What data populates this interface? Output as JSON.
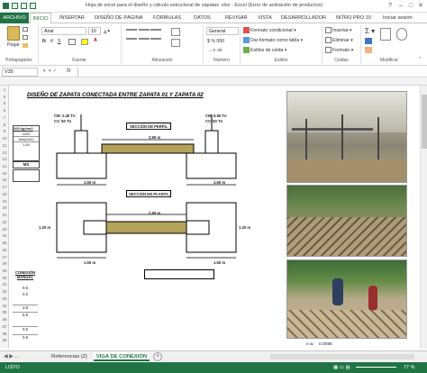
{
  "window": {
    "title": "Hoja de excel para el diseño y cálculo estructural de zapatas .xlsx - Excel (Error de activación de productos)",
    "sign_in": "Iniciar sesión"
  },
  "tabs": {
    "file": "ARCHIVO",
    "items": [
      "INICIO",
      "INSERTAR",
      "DISEÑO DE PÁGINA",
      "FÓRMULAS",
      "DATOS",
      "REVISAR",
      "VISTA",
      "DESARROLLADOR",
      "NITRO PRO 10"
    ]
  },
  "ribbon": {
    "paste": "Pegar",
    "font_name": "Arial",
    "font_size": "10",
    "number_format": "General",
    "conditional_format": "Formato condicional",
    "table_format": "Dar formato como tabla",
    "cell_styles": "Estilos de celda",
    "insert": "Insertar",
    "delete": "Eliminar",
    "format": "Formato",
    "groups": {
      "clipboard": "Portapapeles",
      "font": "Fuente",
      "alignment": "Alineación",
      "number": "Número",
      "styles": "Estilos",
      "cells": "Celdas",
      "modify": "Modificar"
    }
  },
  "formula_bar": {
    "namebox": "V35",
    "fx": "fx"
  },
  "sheet": {
    "title": "DISEÑO DE ZAPATA CONECTADA ENTRE ZAPATA 01 Y ZAPATA 02",
    "labels": {
      "load1": "CM: 2.40 Tn",
      "live1": "CV: 50 Tn",
      "load2": "CM: 6.50 Tn",
      "live2": "CV: 50 Tn",
      "section_profile": "SECCIÓN DE PERFIL",
      "section_plan": "SECCIÓN EN PLANTA",
      "dim_beam": "2.90 m",
      "dim_left": "1.50 m",
      "dim_right": "1.50 m",
      "dim_plan_beam": "2.90 m",
      "dim_plan_left": "1.50 m",
      "dim_plan_right": "1.50 m",
      "dim_h1": "1.20 m",
      "dim_h2": "1.20 m",
      "conexion": "CONEXIÓN MANUAL",
      "gamma": "200 kg/cm2",
      "fy": "4200",
      "alm": "Alm(t/m2)",
      "v1": "1.50",
      "ms": "MS",
      "v2": "0.5",
      "v3": "0.2",
      "v4": "3.8",
      "v5": "6.8",
      "v6": "0.5",
      "v7": "0.8"
    },
    "footer_value": "0.0095",
    "footer_label": "e.w."
  },
  "rows": [
    "1",
    "3",
    "5",
    "6",
    "7",
    "8",
    "9",
    "10",
    "11",
    "12",
    "13",
    "14",
    "15",
    "16",
    "17",
    "18",
    "19",
    "20",
    "21",
    "22",
    "23",
    "24",
    "25",
    "26",
    "27",
    "28",
    "29",
    "30",
    "31",
    "32",
    "33",
    "34",
    "35",
    "36",
    "37",
    "38",
    "39"
  ],
  "sheet_tabs": [
    "Referencias (2)",
    "VIGA DE CONEXIÓN"
  ],
  "status": {
    "ready": "LISTO",
    "zoom": "77 %"
  },
  "colors": {
    "excel_green": "#217346",
    "beam": "#b3a25a"
  }
}
